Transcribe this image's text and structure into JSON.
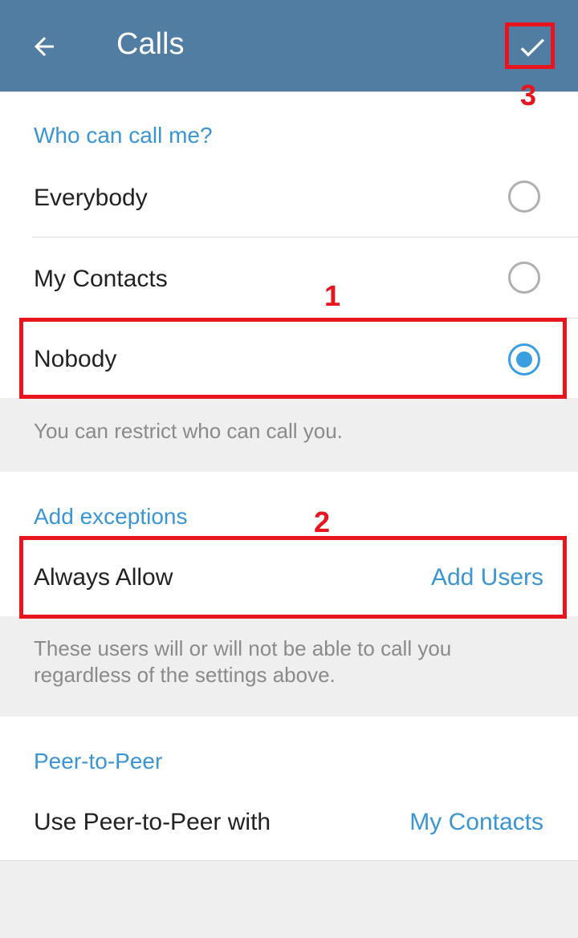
{
  "appbar": {
    "title": "Calls",
    "back_icon": "arrow-left-icon",
    "done_icon": "checkmark-icon"
  },
  "who_can_call": {
    "header": "Who can call me?",
    "options": [
      {
        "label": "Everybody",
        "selected": false
      },
      {
        "label": "My Contacts",
        "selected": false
      },
      {
        "label": "Nobody",
        "selected": true
      }
    ],
    "hint": "You can restrict who can call you."
  },
  "exceptions": {
    "header": "Add exceptions",
    "always_allow_label": "Always Allow",
    "always_allow_value": "Add Users",
    "hint_line1": "These users will or will not be able to call you",
    "hint_line2": "regardless of the settings above."
  },
  "p2p": {
    "header": "Peer-to-Peer",
    "label": "Use Peer-to-Peer with",
    "value": "My Contacts"
  },
  "annotations": [
    "1",
    "2",
    "3"
  ],
  "colors": {
    "appbar": "#517da2",
    "accent": "#3a95d5",
    "annotation": "#e8141e"
  }
}
